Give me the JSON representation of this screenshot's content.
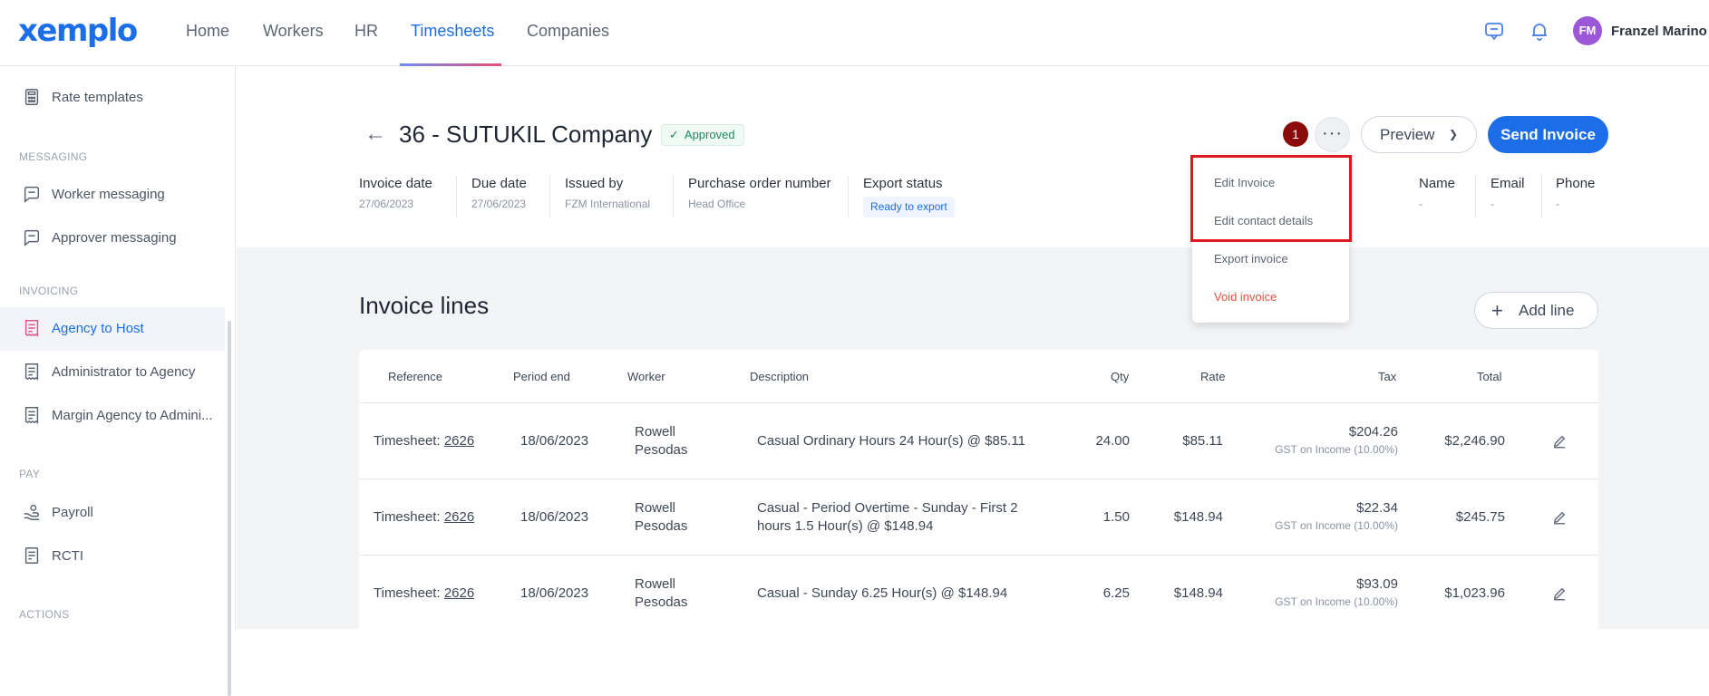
{
  "brand": {
    "logo_text": "xemplo",
    "accent": "#1b6ee8"
  },
  "topnav": {
    "items": [
      {
        "label": "Home"
      },
      {
        "label": "Workers"
      },
      {
        "label": "HR"
      },
      {
        "label": "Timesheets",
        "active": true
      },
      {
        "label": "Companies"
      }
    ],
    "icons": [
      "chat-icon",
      "bell-icon"
    ],
    "user": {
      "initials": "FM",
      "name": "Franzel Marino"
    }
  },
  "sidebar": {
    "items": [
      {
        "label": "Rate templates",
        "icon": "calculator-icon"
      },
      {
        "section": "MESSAGING"
      },
      {
        "label": "Worker messaging",
        "icon": "message-icon"
      },
      {
        "label": "Approver messaging",
        "icon": "message-icon"
      },
      {
        "section": "INVOICING"
      },
      {
        "label": "Agency to Host",
        "icon": "invoice-icon",
        "active": true
      },
      {
        "label": "Administrator to Agency",
        "icon": "invoice-icon"
      },
      {
        "label": "Margin Agency to Admini...",
        "icon": "invoice-icon"
      },
      {
        "section": "PAY"
      },
      {
        "label": "Payroll",
        "icon": "hand-money-icon"
      },
      {
        "label": "RCTI",
        "icon": "receipt-icon"
      },
      {
        "section": "ACTIONS"
      }
    ]
  },
  "header": {
    "title": "36 - SUTUKIL Company",
    "status": "Approved",
    "notification_count": "1",
    "more_label": "···",
    "preview_label": "Preview",
    "send_label": "Send Invoice"
  },
  "meta": {
    "invoice_date": {
      "label": "Invoice date",
      "value": "27/06/2023"
    },
    "due_date": {
      "label": "Due date",
      "value": "27/06/2023"
    },
    "issued_by": {
      "label": "Issued by",
      "value": "FZM International"
    },
    "po_number": {
      "label": "Purchase order number",
      "value": "Head Office"
    },
    "export_status": {
      "label": "Export status",
      "value": "Ready to export"
    },
    "contact": {
      "name": {
        "label": "Name",
        "value": "-"
      },
      "email": {
        "label": "Email",
        "value": "-"
      },
      "phone": {
        "label": "Phone",
        "value": "-"
      }
    }
  },
  "dropdown": {
    "items": [
      {
        "label": "Edit Invoice"
      },
      {
        "label": "Edit contact details"
      },
      {
        "label": "Export invoice"
      },
      {
        "label": "Void invoice",
        "danger": true
      }
    ]
  },
  "invoice_lines": {
    "title": "Invoice lines",
    "add_label": "Add line",
    "columns": {
      "reference": "Reference",
      "period_end": "Period end",
      "worker": "Worker",
      "description": "Description",
      "qty": "Qty",
      "rate": "Rate",
      "tax": "Tax",
      "total": "Total"
    },
    "rows": [
      {
        "ref_prefix": "Timesheet: ",
        "ref_id": "2626",
        "period_end": "18/06/2023",
        "worker_first": "Rowell",
        "worker_last": "Pesodas",
        "desc_1": "Casual Ordinary Hours 24 Hour(s) @ $85.11",
        "desc_2": "",
        "qty": "24.00",
        "rate": "$85.11",
        "tax": "$204.26",
        "tax_note": "GST on Income (10.00%)",
        "total": "$2,246.90"
      },
      {
        "ref_prefix": "Timesheet: ",
        "ref_id": "2626",
        "period_end": "18/06/2023",
        "worker_first": "Rowell",
        "worker_last": "Pesodas",
        "desc_1": "Casual - Period Overtime - Sunday - First 2",
        "desc_2": "hours 1.5 Hour(s) @ $148.94",
        "qty": "1.50",
        "rate": "$148.94",
        "tax": "$22.34",
        "tax_note": "GST on Income (10.00%)",
        "total": "$245.75"
      },
      {
        "ref_prefix": "Timesheet: ",
        "ref_id": "2626",
        "period_end": "18/06/2023",
        "worker_first": "Rowell",
        "worker_last": "Pesodas",
        "desc_1": "Casual - Sunday 6.25 Hour(s) @ $148.94",
        "desc_2": "",
        "qty": "6.25",
        "rate": "$148.94",
        "tax": "$93.09",
        "tax_note": "GST on Income (10.00%)",
        "total": "$1,023.96"
      }
    ]
  }
}
